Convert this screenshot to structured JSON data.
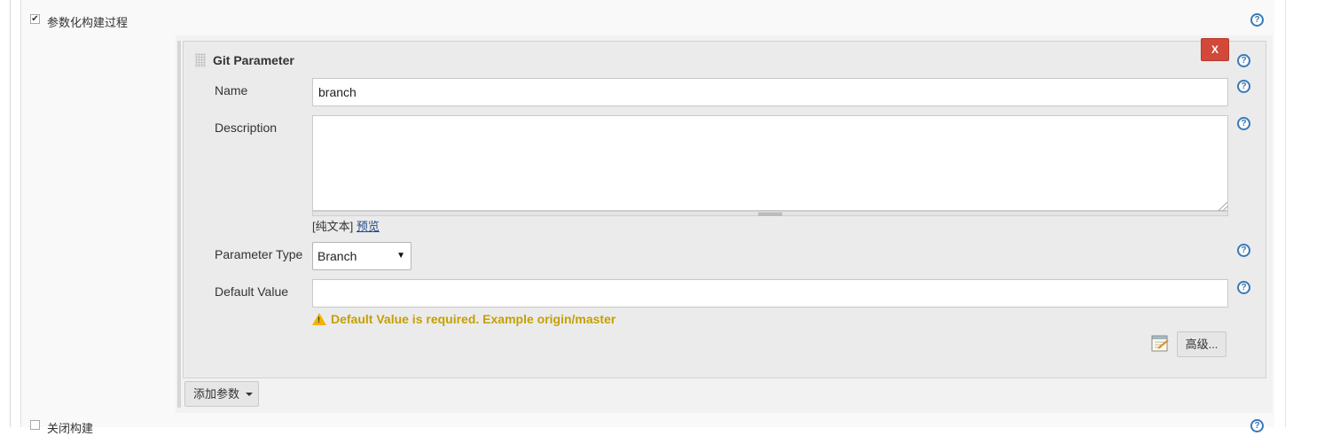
{
  "section": {
    "checkbox_checked": true,
    "label": "参数化构建过程",
    "next_section_label": "关闭构建"
  },
  "param": {
    "title": "Git Parameter",
    "delete_label": "X",
    "name_label": "Name",
    "name_value": "branch",
    "description_label": "Description",
    "description_value": "",
    "format_plain": "[纯文本]",
    "format_preview": "预览",
    "type_label": "Parameter Type",
    "type_value": "Branch",
    "default_label": "Default Value",
    "default_value": "",
    "warning": "Default Value is required. Example origin/master",
    "advanced_label": "高级..."
  },
  "add_param_label": "添加参数",
  "icons": {
    "help": "help-icon",
    "warning": "warning-icon",
    "notepad": "notepad-icon",
    "grip": "drag-handle-icon",
    "caret": "caret-down-icon"
  },
  "colors": {
    "delete_button": "#d24939",
    "help": "#3a79b8",
    "warning": "#c4a000",
    "link": "#204a87"
  }
}
